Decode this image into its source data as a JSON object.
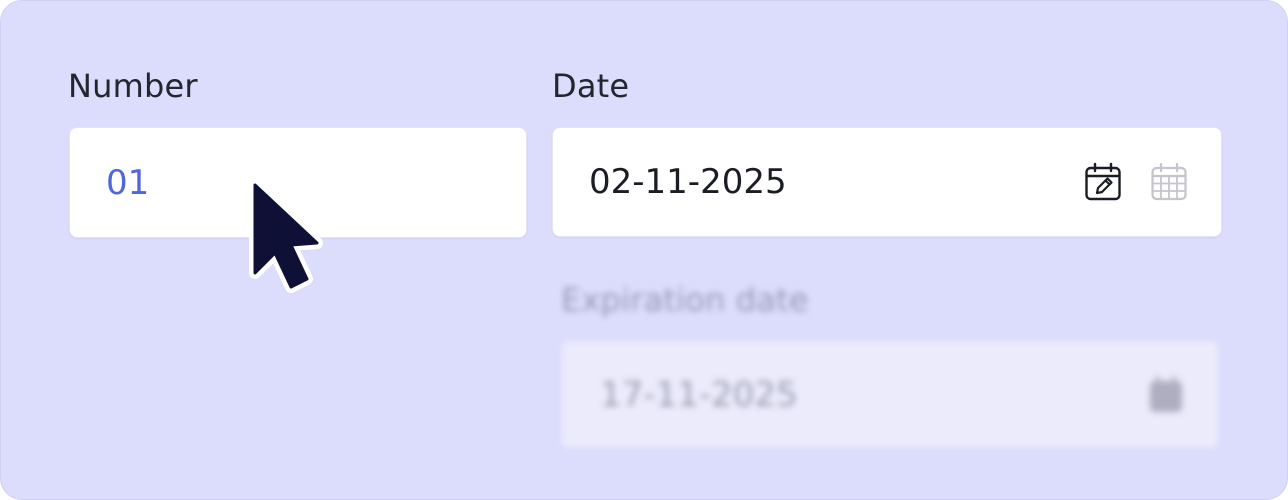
{
  "number": {
    "label": "Number",
    "value": "01"
  },
  "date": {
    "label": "Date",
    "value": "02-11-2025",
    "icons": [
      "calendar-edit-icon",
      "calendar-icon"
    ]
  },
  "expiration": {
    "label": "Expiration date",
    "value": "17-11-2025",
    "icons": [
      "calendar-icon"
    ]
  },
  "colors": {
    "background": "#dcdcfd",
    "number_value": "#5165dd",
    "text": "#23252f",
    "cursor": "#0f1036"
  },
  "pointer": "mouse-pointer-icon"
}
